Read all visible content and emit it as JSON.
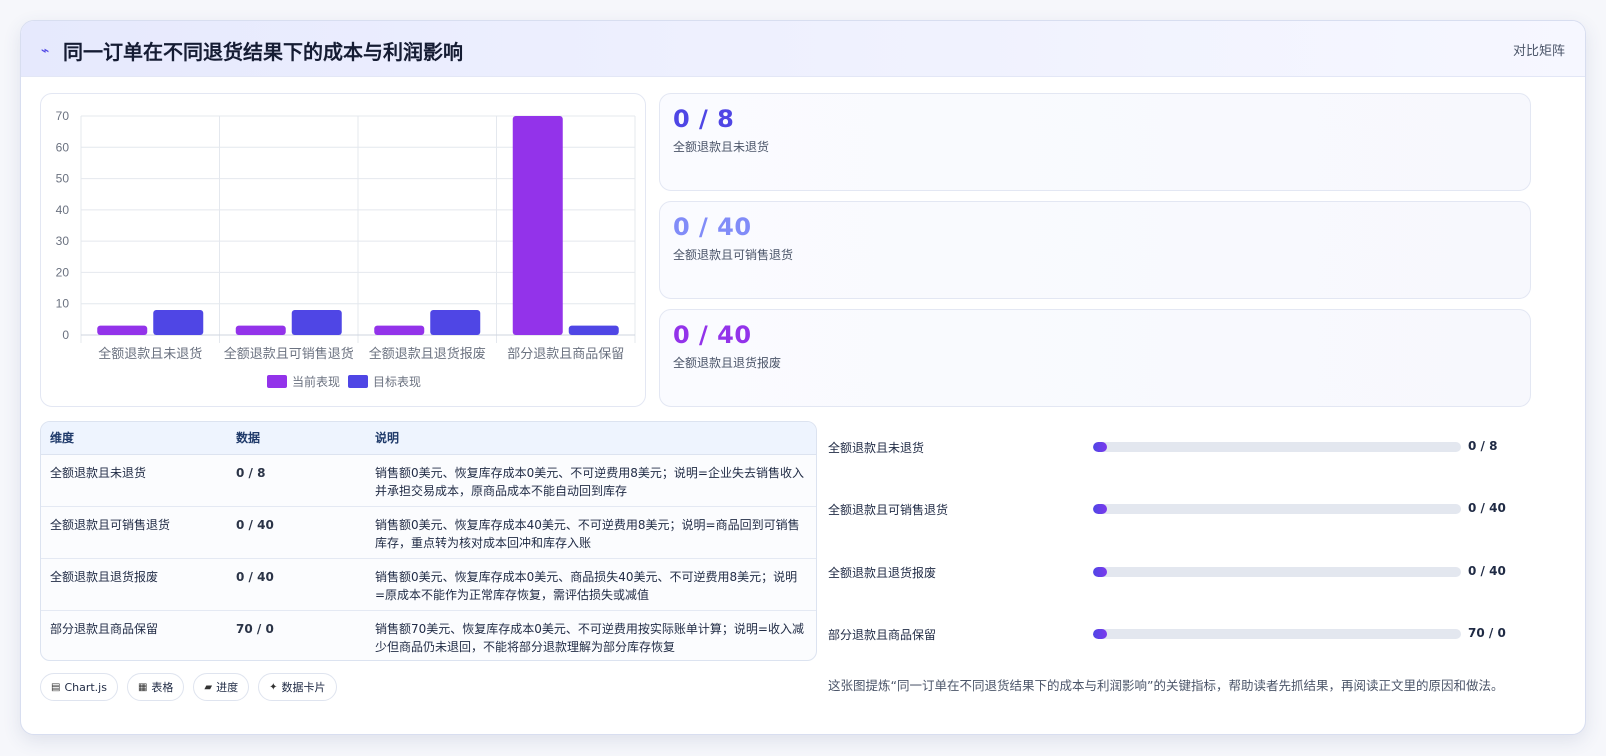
{
  "header": {
    "icon": "pulse-icon",
    "title": "同一订单在不同退货结果下的成本与利润影响",
    "tag": "对比矩阵"
  },
  "colors": {
    "current": "#9333ea",
    "target": "#4f46e5",
    "stat_1": "#4f46e5",
    "stat_2": "#818cf8",
    "stat_3": "#9333ea"
  },
  "chart_data": {
    "type": "bar",
    "categories": [
      "全额退款且未退货",
      "全额退款且可销售退货",
      "全额退款且退货报废",
      "部分退款且商品保留"
    ],
    "series": [
      {
        "name": "当前表现",
        "values": [
          3,
          3,
          3,
          70
        ]
      },
      {
        "name": "目标表现",
        "values": [
          8,
          8,
          8,
          3
        ]
      }
    ],
    "ylim": [
      0,
      70
    ],
    "yticks": [
      0,
      10,
      20,
      30,
      40,
      50,
      60,
      70
    ],
    "grid": true,
    "legend": "bottom"
  },
  "stats": [
    {
      "value": "0 / 8",
      "label": "全额退款且未退货"
    },
    {
      "value": "0 / 40",
      "label": "全额退款且可销售退货"
    },
    {
      "value": "0 / 40",
      "label": "全额退款且退货报废"
    }
  ],
  "table": {
    "headers": [
      "维度",
      "数据",
      "说明"
    ],
    "rows": [
      {
        "dim": "全额退款且未退货",
        "data": "0 / 8",
        "desc": "销售额0美元、恢复库存成本0美元、不可逆费用8美元；说明=企业失去销售收入并承担交易成本，原商品成本不能自动回到库存"
      },
      {
        "dim": "全额退款且可销售退货",
        "data": "0 / 40",
        "desc": "销售额0美元、恢复库存成本40美元、不可逆费用8美元；说明=商品回到可销售库存，重点转为核对成本回冲和库存入账"
      },
      {
        "dim": "全额退款且退货报废",
        "data": "0 / 40",
        "desc": "销售额0美元、恢复库存成本0美元、商品损失40美元、不可逆费用8美元；说明=原成本不能作为正常库存恢复，需评估损失或减值"
      },
      {
        "dim": "部分退款且商品保留",
        "data": "70 / 0",
        "desc": "销售额70美元、恢复库存成本0美元、不可逆费用按实际账单计算；说明=收入减少但商品仍未退回，不能将部分退款理解为部分库存恢复"
      }
    ]
  },
  "tags": [
    {
      "icon": "chart-icon",
      "glyph": "▤",
      "label": "Chart.js"
    },
    {
      "icon": "table-icon",
      "glyph": "▦",
      "label": "表格"
    },
    {
      "icon": "progress-icon",
      "glyph": "▰",
      "label": "进度"
    },
    {
      "icon": "sparkle-icon",
      "glyph": "✦",
      "label": "数据卡片"
    }
  ],
  "progress": [
    {
      "label": "全额退款且未退货",
      "value": "0 / 8",
      "fraction": 0
    },
    {
      "label": "全额退款且可销售退货",
      "value": "0 / 40",
      "fraction": 0
    },
    {
      "label": "全额退款且退货报废",
      "value": "0 / 40",
      "fraction": 0
    },
    {
      "label": "部分退款且商品保留",
      "value": "70 / 0",
      "fraction": 0
    }
  ],
  "note": "这张图提炼“同一订单在不同退货结果下的成本与利润影响”的关键指标，帮助读者先抓结果，再阅读正文里的原因和做法。"
}
